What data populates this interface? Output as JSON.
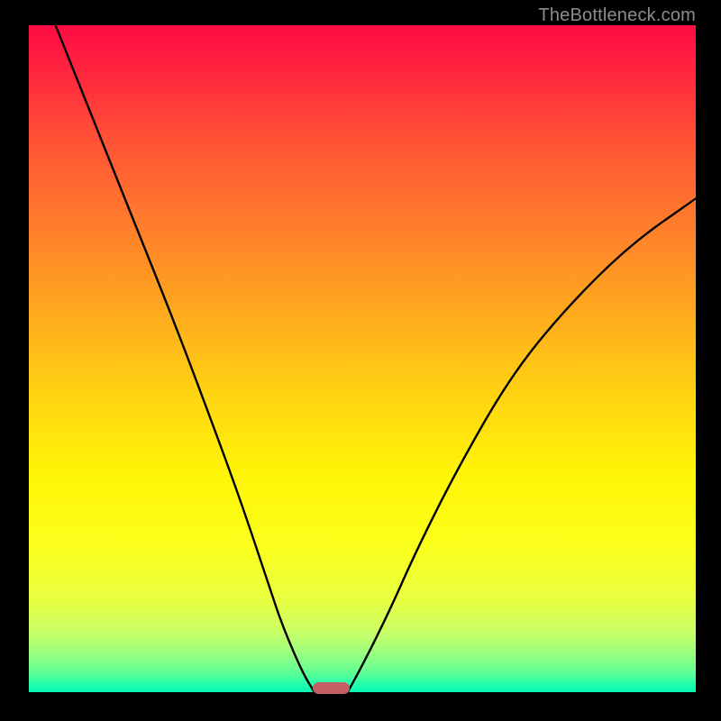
{
  "watermark": "TheBottleneck.com",
  "chart_data": {
    "type": "line",
    "title": "",
    "xlabel": "",
    "ylabel": "",
    "xlim": [
      0,
      100
    ],
    "ylim": [
      0,
      100
    ],
    "gradient_colors": {
      "top": "#ff0a44",
      "mid": "#ffe607",
      "bottom": "#06f7b0"
    },
    "series": [
      {
        "name": "left curve",
        "x": [
          4,
          10,
          16,
          22,
          28,
          32,
          36,
          38,
          41,
          42.8
        ],
        "y": [
          100,
          85,
          70,
          55,
          39,
          28,
          16,
          10,
          3,
          0
        ]
      },
      {
        "name": "right curve",
        "x": [
          47.8,
          50,
          54,
          58,
          64,
          72,
          80,
          90,
          100
        ],
        "y": [
          0,
          4,
          12,
          21,
          33,
          47,
          57,
          67,
          74
        ]
      }
    ],
    "marker": {
      "x_start": 42.5,
      "x_end": 48.1,
      "y": 0.7,
      "color": "#c46065"
    }
  }
}
